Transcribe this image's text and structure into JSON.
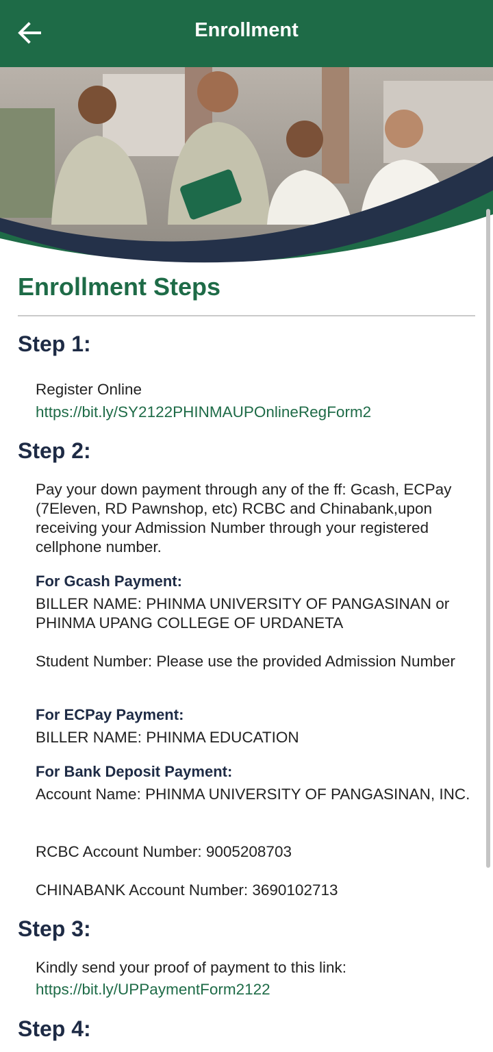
{
  "app_bar": {
    "title": "Enrollment",
    "back_icon": "arrow-left-icon",
    "bg_color": "#1e6b47"
  },
  "hero": {
    "image": "students-banner",
    "accent_colors": [
      "#1e6b47",
      "#243149"
    ]
  },
  "main": {
    "heading": "Enrollment Steps",
    "heading_color": "#1e6b47",
    "step1": {
      "title": "Step 1:",
      "text": "Register Online",
      "link": "https://bit.ly/SY2122PHINMAUPOnlineRegForm2"
    },
    "step2": {
      "title": "Step 2:",
      "intro": "Pay your down payment through any of the ff: Gcash, ECPay (7Eleven, RD Pawnshop, etc) RCBC and Chinabank,upon receiving your Admission Number through your registered cellphone number.",
      "gcash_heading": "For Gcash Payment:",
      "gcash_biller": "BILLER NAME: PHINMA UNIVERSITY OF PANGASINAN or PHINMA UPANG COLLEGE OF URDANETA",
      "gcash_student": "Student Number: Please use the provided Admission Number",
      "ecpay_heading": "For ECPay Payment:",
      "ecpay_biller": "BILLER NAME: PHINMA EDUCATION",
      "bank_heading": "For Bank Deposit Payment:",
      "bank_account_name": "Account Name: PHINMA UNIVERSITY OF PANGASINAN, INC.",
      "rcbc": "RCBC Account Number: 9005208703",
      "chinabank": "CHINABANK Account Number: 3690102713"
    },
    "step3": {
      "title": "Step 3:",
      "text": "Kindly send your proof of payment to this link:",
      "link": "https://bit.ly/UPPaymentForm2122"
    },
    "step4": {
      "title": "Step 4:"
    }
  }
}
